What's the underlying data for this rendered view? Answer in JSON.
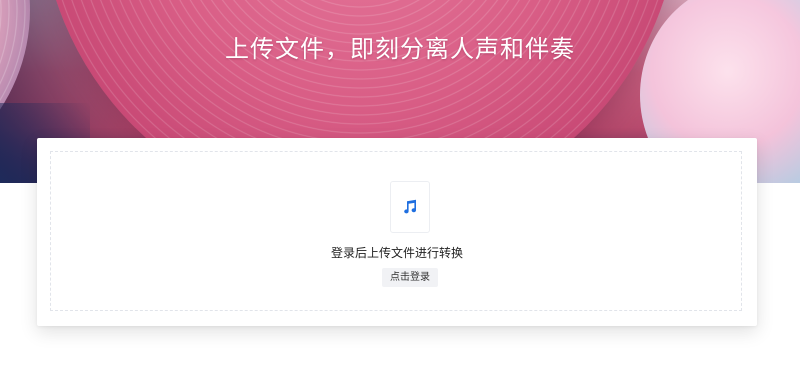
{
  "hero": {
    "title": "上传文件，即刻分离人声和伴奏"
  },
  "upload": {
    "icon": "music-note-icon",
    "prompt": "登录后上传文件进行转换",
    "login_button": "点击登录"
  },
  "colors": {
    "accent": "#1f6fe0",
    "hero_pink": "#d95e86"
  }
}
